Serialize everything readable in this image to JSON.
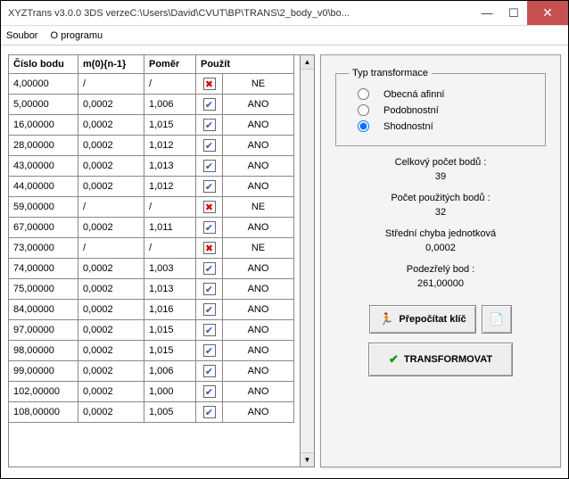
{
  "window": {
    "title": "XYZTrans v3.0.0 3DS verzeC:\\Users\\David\\CVUT\\BP\\TRANS\\2_body_v0\\bo..."
  },
  "menu": {
    "soubor": "Soubor",
    "oprogramu": "O programu"
  },
  "table": {
    "headers": {
      "cislo": "Číslo bodu",
      "m0": "m(0){n-1}",
      "pomer": "Poměr",
      "pouzit": "Použít"
    },
    "rows": [
      {
        "cislo": "4,00000",
        "m0": "/",
        "pomer": "/",
        "use": false,
        "usetxt": "NE"
      },
      {
        "cislo": "5,00000",
        "m0": "0,0002",
        "pomer": "1,006",
        "use": true,
        "usetxt": "ANO"
      },
      {
        "cislo": "16,00000",
        "m0": "0,0002",
        "pomer": "1,015",
        "use": true,
        "usetxt": "ANO"
      },
      {
        "cislo": "28,00000",
        "m0": "0,0002",
        "pomer": "1,012",
        "use": true,
        "usetxt": "ANO"
      },
      {
        "cislo": "43,00000",
        "m0": "0,0002",
        "pomer": "1,013",
        "use": true,
        "usetxt": "ANO"
      },
      {
        "cislo": "44,00000",
        "m0": "0,0002",
        "pomer": "1,012",
        "use": true,
        "usetxt": "ANO"
      },
      {
        "cislo": "59,00000",
        "m0": "/",
        "pomer": "/",
        "use": false,
        "usetxt": "NE"
      },
      {
        "cislo": "67,00000",
        "m0": "0,0002",
        "pomer": "1,011",
        "use": true,
        "usetxt": "ANO"
      },
      {
        "cislo": "73,00000",
        "m0": "/",
        "pomer": "/",
        "use": false,
        "usetxt": "NE"
      },
      {
        "cislo": "74,00000",
        "m0": "0,0002",
        "pomer": "1,003",
        "use": true,
        "usetxt": "ANO"
      },
      {
        "cislo": "75,00000",
        "m0": "0,0002",
        "pomer": "1,013",
        "use": true,
        "usetxt": "ANO"
      },
      {
        "cislo": "84,00000",
        "m0": "0,0002",
        "pomer": "1,016",
        "use": true,
        "usetxt": "ANO"
      },
      {
        "cislo": "97,00000",
        "m0": "0,0002",
        "pomer": "1,015",
        "use": true,
        "usetxt": "ANO"
      },
      {
        "cislo": "98,00000",
        "m0": "0,0002",
        "pomer": "1,015",
        "use": true,
        "usetxt": "ANO"
      },
      {
        "cislo": "99,00000",
        "m0": "0,0002",
        "pomer": "1,006",
        "use": true,
        "usetxt": "ANO"
      },
      {
        "cislo": "102,00000",
        "m0": "0,0002",
        "pomer": "1,000",
        "use": true,
        "usetxt": "ANO"
      },
      {
        "cislo": "108,00000",
        "m0": "0,0002",
        "pomer": "1,005",
        "use": true,
        "usetxt": "ANO"
      }
    ]
  },
  "panel": {
    "typ_legend": "Typ transformace",
    "radio": {
      "afinni": "Obecná afinní",
      "podob": "Podobnostní",
      "shod": "Shodnostní"
    },
    "stats": {
      "total_lbl": "Celkový počet bodů :",
      "total_val": "39",
      "used_lbl": "Počet použitých bodů :",
      "used_val": "32",
      "err_lbl": "Střední chyba jednotková",
      "err_val": "0,0002",
      "susp_lbl": "Podezřelý bod :",
      "susp_val": "261,00000"
    },
    "buttons": {
      "recalc": "Přepočítat klíč",
      "transform": "TRANSFORMOVAT"
    }
  }
}
